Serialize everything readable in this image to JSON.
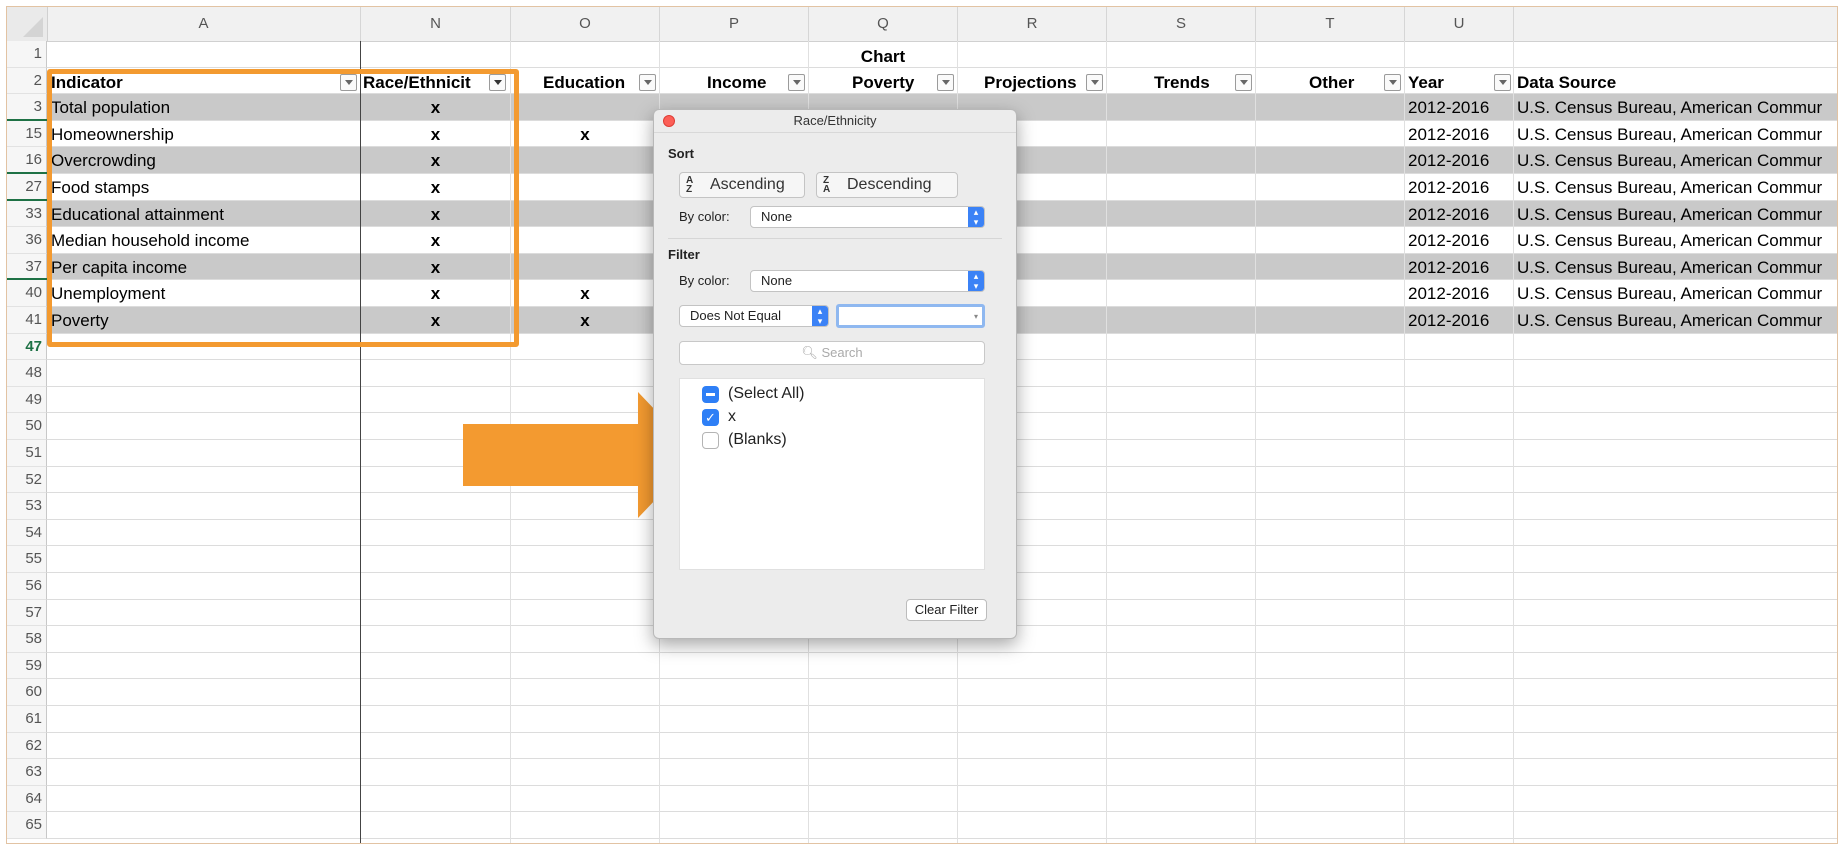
{
  "columns": {
    "A": "A",
    "N": "N",
    "O": "O",
    "P": "P",
    "Q": "Q",
    "R": "R",
    "S": "S",
    "T": "T",
    "U": "U"
  },
  "chart_group_label": "Chart",
  "headers": {
    "indicator": "Indicator",
    "race": "Race/Ethnicit",
    "education": "Education",
    "income": "Income",
    "poverty": "Poverty",
    "projections": "Projections",
    "trends": "Trends",
    "other": "Other",
    "year": "Year",
    "source": "Data Source"
  },
  "row_numbers": [
    "1",
    "2",
    "3",
    "15",
    "16",
    "27",
    "33",
    "36",
    "37",
    "40",
    "41",
    "47",
    "48",
    "49",
    "50",
    "51",
    "52",
    "53",
    "54",
    "55",
    "56",
    "57",
    "58",
    "59",
    "60",
    "61",
    "62",
    "63",
    "64",
    "65"
  ],
  "data_rows": [
    {
      "row": "3",
      "indicator": "Total population",
      "race": "x",
      "education": "",
      "year": "2012-2016",
      "source": "U.S. Census Bureau, American Commur"
    },
    {
      "row": "15",
      "indicator": "Homeownership",
      "race": "x",
      "education": "x",
      "year": "2012-2016",
      "source": "U.S. Census Bureau, American Commur"
    },
    {
      "row": "16",
      "indicator": "Overcrowding",
      "race": "x",
      "education": "",
      "year": "2012-2016",
      "source": "U.S. Census Bureau, American Commur"
    },
    {
      "row": "27",
      "indicator": "Food stamps",
      "race": "x",
      "education": "",
      "year": "2012-2016",
      "source": "U.S. Census Bureau, American Commur"
    },
    {
      "row": "33",
      "indicator": "Educational attainment",
      "race": "x",
      "education": "",
      "year": "2012-2016",
      "source": "U.S. Census Bureau, American Commur"
    },
    {
      "row": "36",
      "indicator": "Median household income",
      "race": "x",
      "education": "",
      "year": "2012-2016",
      "source": "U.S. Census Bureau, American Commur"
    },
    {
      "row": "37",
      "indicator": "Per capita income",
      "race": "x",
      "education": "",
      "year": "2012-2016",
      "source": "U.S. Census Bureau, American Commur"
    },
    {
      "row": "40",
      "indicator": "Unemployment",
      "race": "x",
      "education": "x",
      "year": "2012-2016",
      "source": "U.S. Census Bureau, American Commur"
    },
    {
      "row": "41",
      "indicator": "Poverty",
      "race": "x",
      "education": "x",
      "year": "2012-2016",
      "source": "U.S. Census Bureau, American Commur"
    }
  ],
  "dialog": {
    "title": "Race/Ethnicity",
    "sort_label": "Sort",
    "ascending": "Ascending",
    "descending": "Descending",
    "by_color_label": "By color:",
    "sort_color_value": "None",
    "filter_label": "Filter",
    "filter_color_value": "None",
    "condition": "Does Not Equal",
    "condition_value": "",
    "search_placeholder": "Search",
    "items": [
      {
        "label": "(Select All)",
        "state": "mixed"
      },
      {
        "label": "x",
        "state": "checked"
      },
      {
        "label": "(Blanks)",
        "state": "unchecked"
      }
    ],
    "clear_filter": "Clear Filter"
  },
  "colors": {
    "highlight_orange": "#f39a30",
    "row_gray": "#c9c9c9",
    "row_number_green": "#1e7145",
    "checkbox_blue": "#2e7ff6"
  }
}
